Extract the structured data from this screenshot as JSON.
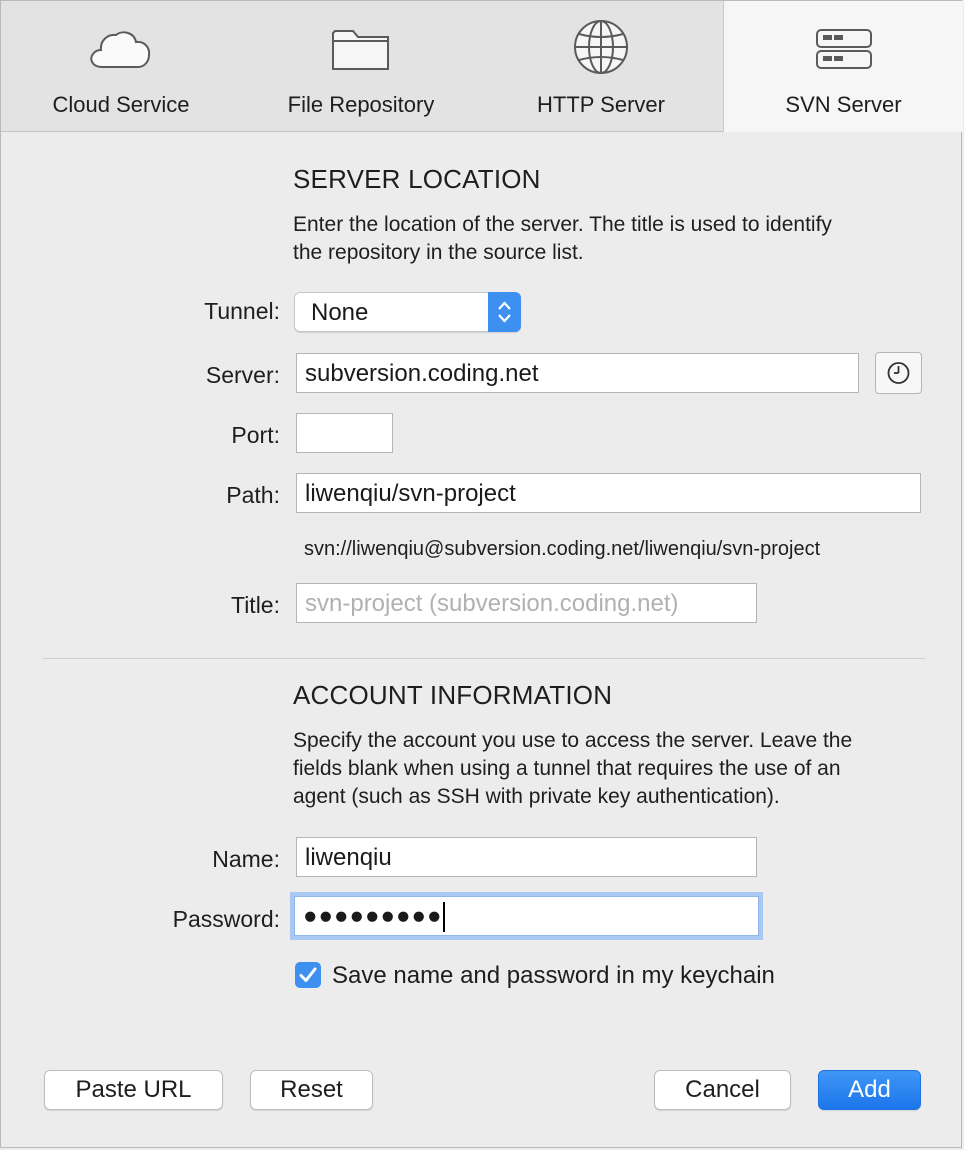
{
  "tabs": [
    {
      "label": "Cloud Service",
      "icon": "cloud-icon"
    },
    {
      "label": "File Repository",
      "icon": "folder-icon"
    },
    {
      "label": "HTTP Server",
      "icon": "globe-icon"
    },
    {
      "label": "SVN Server",
      "icon": "server-icon",
      "active": true
    }
  ],
  "server_location": {
    "title": "SERVER LOCATION",
    "description_line1": "Enter the location of the server. The title is used to identify",
    "description_line2": "the repository in the source list.",
    "tunnel_label": "Tunnel:",
    "tunnel_value": "None",
    "server_label": "Server:",
    "server_value": "subversion.coding.net",
    "port_label": "Port:",
    "port_value": "",
    "path_label": "Path:",
    "path_value": "liwenqiu/svn-project",
    "url_preview": "svn://liwenqiu@subversion.coding.net/liwenqiu/svn-project",
    "title_label": "Title:",
    "title_placeholder": "svn-project (subversion.coding.net)"
  },
  "account": {
    "title": "ACCOUNT INFORMATION",
    "description_line1": "Specify the account you use to access the server. Leave the",
    "description_line2": "fields blank when using a tunnel that requires the use of an",
    "description_line3": "agent (such as SSH with private key authentication).",
    "name_label": "Name:",
    "name_value": "liwenqiu",
    "password_label": "Password:",
    "password_value": "●●●●●●●●●",
    "keychain_label": "Save name and password in my keychain",
    "keychain_checked": true
  },
  "buttons": {
    "paste_url": "Paste URL",
    "reset": "Reset",
    "cancel": "Cancel",
    "add": "Add"
  },
  "colors": {
    "accent": "#3d8ff0",
    "focus_ring": "#a9c8f2",
    "placeholder": "#b1b1b1"
  }
}
